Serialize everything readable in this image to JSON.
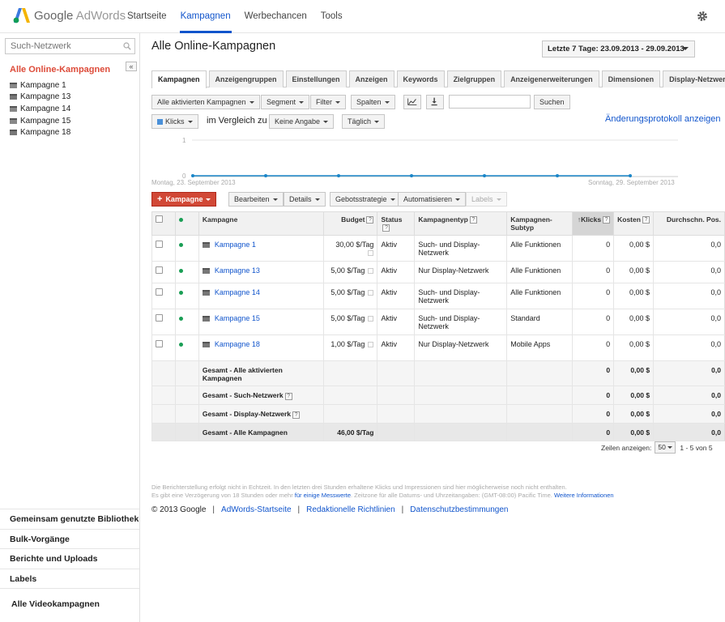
{
  "header": {
    "logo_google": "Google",
    "logo_product": "AdWords",
    "nav": [
      "Startseite",
      "Kampagnen",
      "Werbechancen",
      "Tools"
    ],
    "active_nav": "Kampagnen"
  },
  "sidebar": {
    "search_placeholder": "Such-Netzwerk",
    "collapse_label": "«",
    "all_campaigns": "Alle Online-Kampagnen",
    "campaigns": [
      "Kampagne 1",
      "Kampagne 13",
      "Kampagne 14",
      "Kampagne 15",
      "Kampagne 18"
    ],
    "bottom_items": [
      "Gemeinsam genutzte Bibliothek",
      "Bulk-Vorgänge",
      "Berichte und Uploads",
      "Labels"
    ],
    "video_campaigns": "Alle Videokampagnen"
  },
  "main": {
    "title": "Alle Online-Kampagnen",
    "date_range": "Letzte 7 Tage: 23.09.2013 - 29.09.2013",
    "tabs": [
      "Kampagnen",
      "Anzeigengruppen",
      "Einstellungen",
      "Anzeigen",
      "Keywords",
      "Zielgruppen",
      "Anzeigenerweiterungen",
      "Dimensionen",
      "Display-Netzwerk"
    ],
    "toolbar": {
      "filter_campaigns": "Alle aktivierten Kampagnen",
      "segment": "Segment",
      "filter": "Filter",
      "columns": "Spalten",
      "search_value": "",
      "search_button": "Suchen"
    },
    "chart_controls": {
      "metric": "Klicks",
      "compare_label": "im Vergleich zu",
      "compare_value": "Keine Angabe",
      "interval": "Täglich",
      "change_log": "Änderungsprotokoll anzeigen"
    },
    "chart": {
      "y_max_label": "1",
      "y_min_label": "0",
      "start_label": "Montag, 23. September 2013",
      "end_label": "Sonntag, 29. September 2013"
    },
    "actions": {
      "new_campaign": "Kampagne",
      "edit": "Bearbeiten",
      "details": "Details",
      "bid_strategy": "Gebotsstrategie",
      "automate": "Automatisieren",
      "labels": "Labels"
    },
    "table": {
      "headers": {
        "campaign": "Kampagne",
        "budget": "Budget",
        "status": "Status",
        "type": "Kampagnentyp",
        "subtype": "Kampagnen-Subtyp",
        "clicks": "Klicks",
        "cost": "Kosten",
        "avg_pos": "Durchschn. Pos."
      },
      "rows": [
        {
          "name": "Kampagne 1",
          "budget": "30,00 $/Tag",
          "status": "Aktiv",
          "type": "Such- und Display-Netzwerk",
          "subtype": "Alle Funktionen",
          "clicks": "0",
          "cost": "0,00 $",
          "pos": "0,0"
        },
        {
          "name": "Kampagne 13",
          "budget": "5,00 $/Tag",
          "status": "Aktiv",
          "type": "Nur Display-Netzwerk",
          "subtype": "Alle Funktionen",
          "clicks": "0",
          "cost": "0,00 $",
          "pos": "0,0"
        },
        {
          "name": "Kampagne 14",
          "budget": "5,00 $/Tag",
          "status": "Aktiv",
          "type": "Such- und Display-Netzwerk",
          "subtype": "Alle Funktionen",
          "clicks": "0",
          "cost": "0,00 $",
          "pos": "0,0"
        },
        {
          "name": "Kampagne 15",
          "budget": "5,00 $/Tag",
          "status": "Aktiv",
          "type": "Such- und Display-Netzwerk",
          "subtype": "Standard",
          "clicks": "0",
          "cost": "0,00 $",
          "pos": "0,0"
        },
        {
          "name": "Kampagne 18",
          "budget": "1,00 $/Tag",
          "status": "Aktiv",
          "type": "Nur Display-Netzwerk",
          "subtype": "Mobile Apps",
          "clicks": "0",
          "cost": "0,00 $",
          "pos": "0,0"
        }
      ],
      "totals": [
        {
          "label": "Gesamt - Alle aktivierten Kampagnen",
          "budget": "",
          "clicks": "0",
          "cost": "0,00 $",
          "pos": "0,0"
        },
        {
          "label": "Gesamt - Such-Netzwerk",
          "budget": "",
          "clicks": "0",
          "cost": "0,00 $",
          "pos": "0,0"
        },
        {
          "label": "Gesamt - Display-Netzwerk",
          "budget": "",
          "clicks": "0",
          "cost": "0,00 $",
          "pos": "0,0"
        }
      ],
      "grand_total": {
        "label": "Gesamt - Alle Kampagnen",
        "budget": "46,00 $/Tag",
        "clicks": "0",
        "cost": "0,00 $",
        "pos": "0,0"
      }
    },
    "pager": {
      "rows_label": "Zeilen anzeigen:",
      "rows_value": "50",
      "range": "1 - 5 von 5"
    },
    "notice": {
      "line1": "Die Berichterstellung erfolgt nicht in Echtzeit. In den letzten drei Stunden erhaltene Klicks und Impressionen sind hier möglicherweise noch nicht enthalten.",
      "line2_pre": "Es gibt eine Verzögerung von 18 Stunden oder mehr",
      "line2_link1": "für einige Messwerte",
      "line2_mid": ". Zeitzone für alle Datums- und Uhrzeitangaben: (GMT-08:00) Pacific Time.",
      "line2_link2": "Weitere Informationen"
    },
    "footer": {
      "copyright": "© 2013 Google",
      "links": [
        "AdWords-Startseite",
        "Redaktionelle Richtlinien",
        "Datenschutzbestimmungen"
      ]
    }
  }
}
